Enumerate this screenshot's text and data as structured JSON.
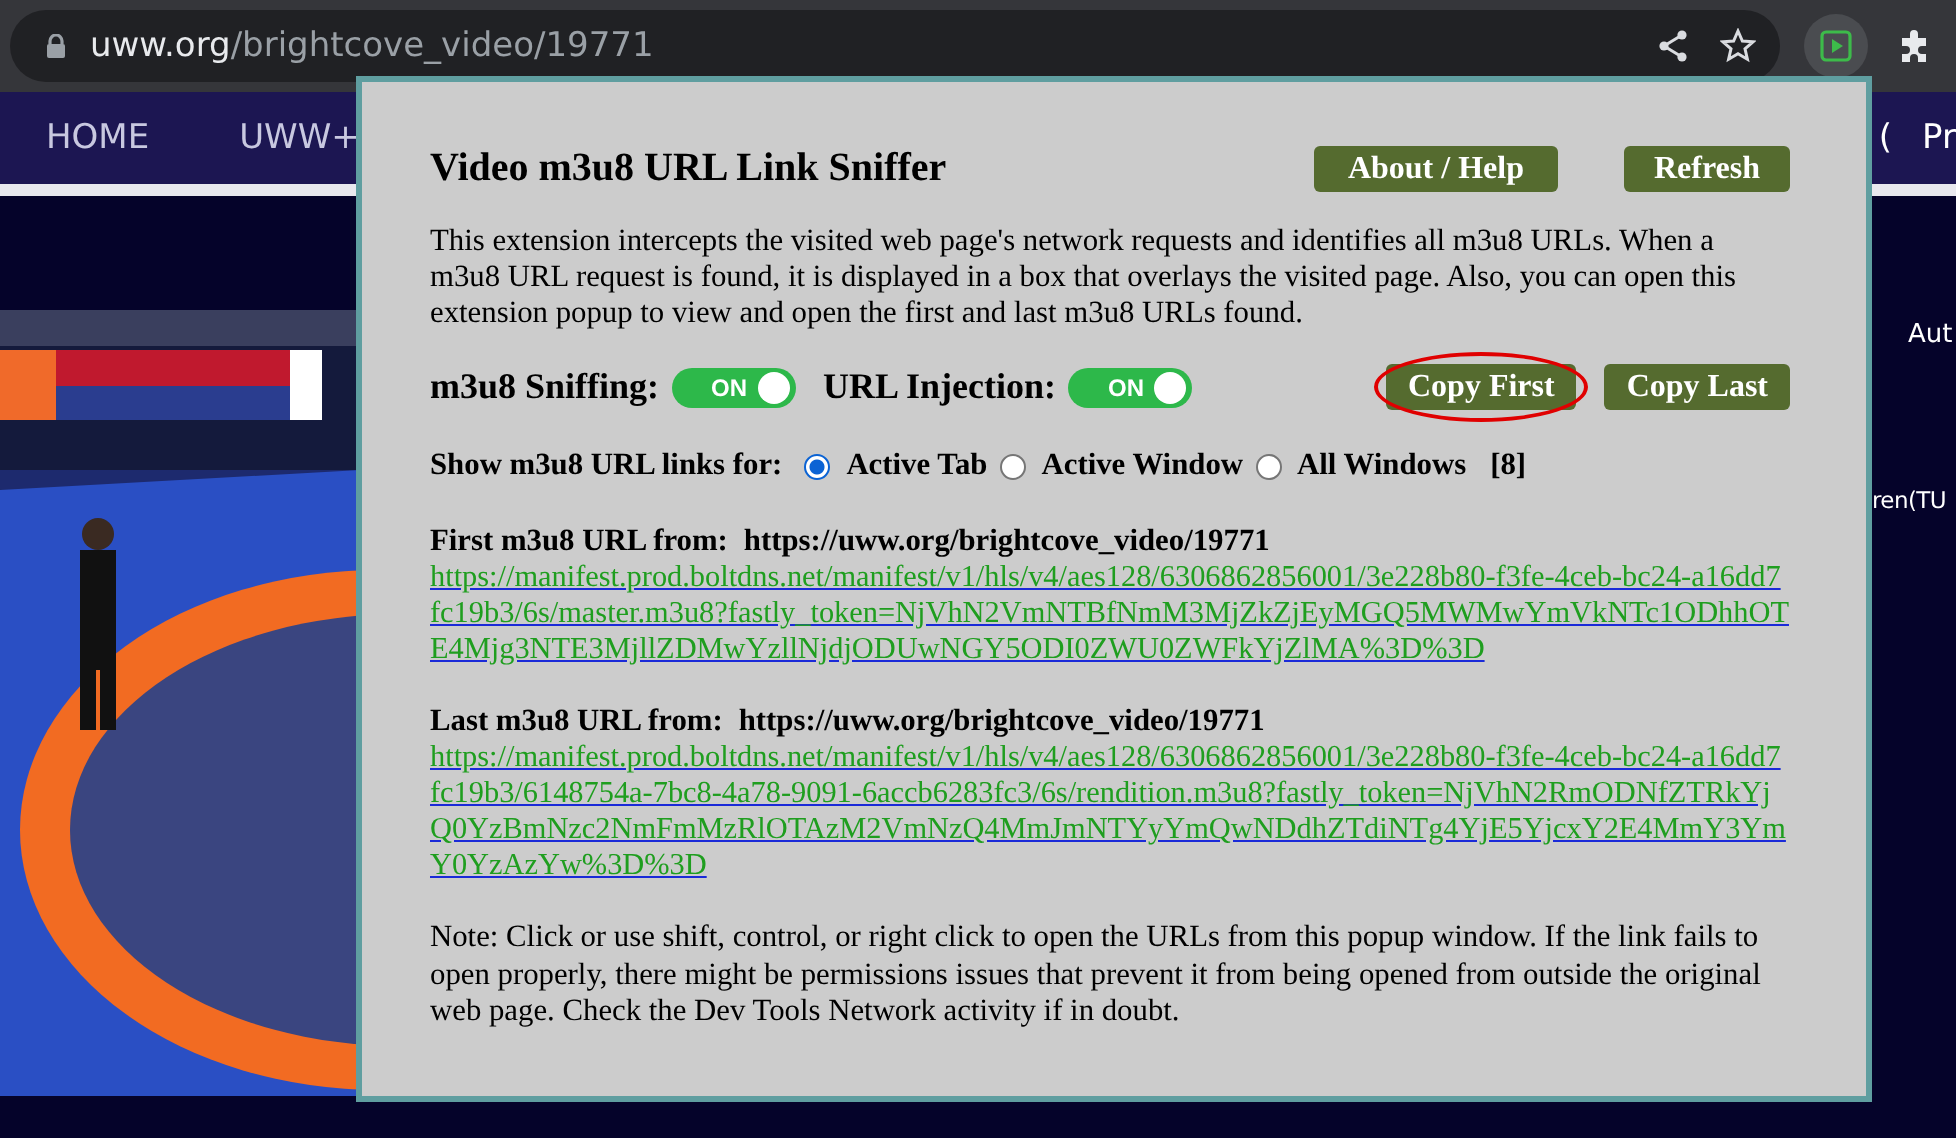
{
  "browser": {
    "url_host": "uww.org",
    "url_path": "/brightcove_video/19771"
  },
  "page": {
    "nav": [
      "HOME",
      "UWW+"
    ],
    "nav_right": [
      "(",
      "Pr"
    ],
    "side_texts": [
      "Aut",
      "ren(TU"
    ],
    "video": {
      "kind": "picture"
    }
  },
  "popup": {
    "title": "Video m3u8 URL Link Sniffer",
    "header_buttons": [
      "About / Help",
      "Refresh"
    ],
    "description": "This extension intercepts the visited web page's network requests and identifies all m3u8 URLs. When a m3u8 URL request is found, it is displayed in a box that overlays the visited page. Also, you can open this extension popup to view and open the first and last m3u8 URLs found.",
    "toggles": [
      {
        "label": "m3u8 Sniffing:",
        "on": true,
        "state_text": "ON"
      },
      {
        "label": "URL Injection:",
        "on": true,
        "state_text": "ON"
      }
    ],
    "copy_buttons": [
      {
        "label": "Copy First",
        "highlighted": true
      },
      {
        "label": "Copy Last",
        "highlighted": false
      }
    ],
    "show_for": {
      "label": "Show m3u8 URL links for:",
      "options": [
        {
          "label": "Active Tab",
          "selected": true
        },
        {
          "label": "Active Window",
          "selected": false
        },
        {
          "label": "All Windows",
          "selected": false
        }
      ],
      "count": "[8]"
    },
    "sections": [
      {
        "label": "First m3u8 URL from:",
        "source": "https://uww.org/brightcove_video/19771",
        "url": "https://manifest.prod.boltdns.net/manifest/v1/hls/v4/aes128/6306862856001/3e228b80-f3fe-4ceb-bc24-a16dd7fc19b3/6s/master.m3u8?fastly_token=NjVhN2VmNTBfNmM3MjZkZjEyMGQ5MWMwYmVkNTc1ODhhOTE4Mjg3NTE3MjllZDMwYzllNjdjODUwNGY5ODI0ZWU0ZWFkYjZlMA%3D%3D"
      },
      {
        "label": "Last m3u8 URL from:",
        "source": "https://uww.org/brightcove_video/19771",
        "url": "https://manifest.prod.boltdns.net/manifest/v1/hls/v4/aes128/6306862856001/3e228b80-f3fe-4ceb-bc24-a16dd7fc19b3/6148754a-7bc8-4a78-9091-6accb6283fc3/6s/rendition.m3u8?fastly_token=NjVhN2RmODNfZTRkYjQ0YzBmNzc2NmFmMzRlOTAzM2VmNzQ4MmJmNTYyYmQwNDdhZTdiNTg4YjE5YjcxY2E4MmY3YmY0YzAzYw%3D%3D"
      }
    ],
    "note": "Note: Click or use shift, control, or right click to open the URLs from this popup window. If the link fails to open properly, there might be permissions issues that prevent it from being opened from outside the original web page. Check the Dev Tools Network activity if in doubt."
  }
}
